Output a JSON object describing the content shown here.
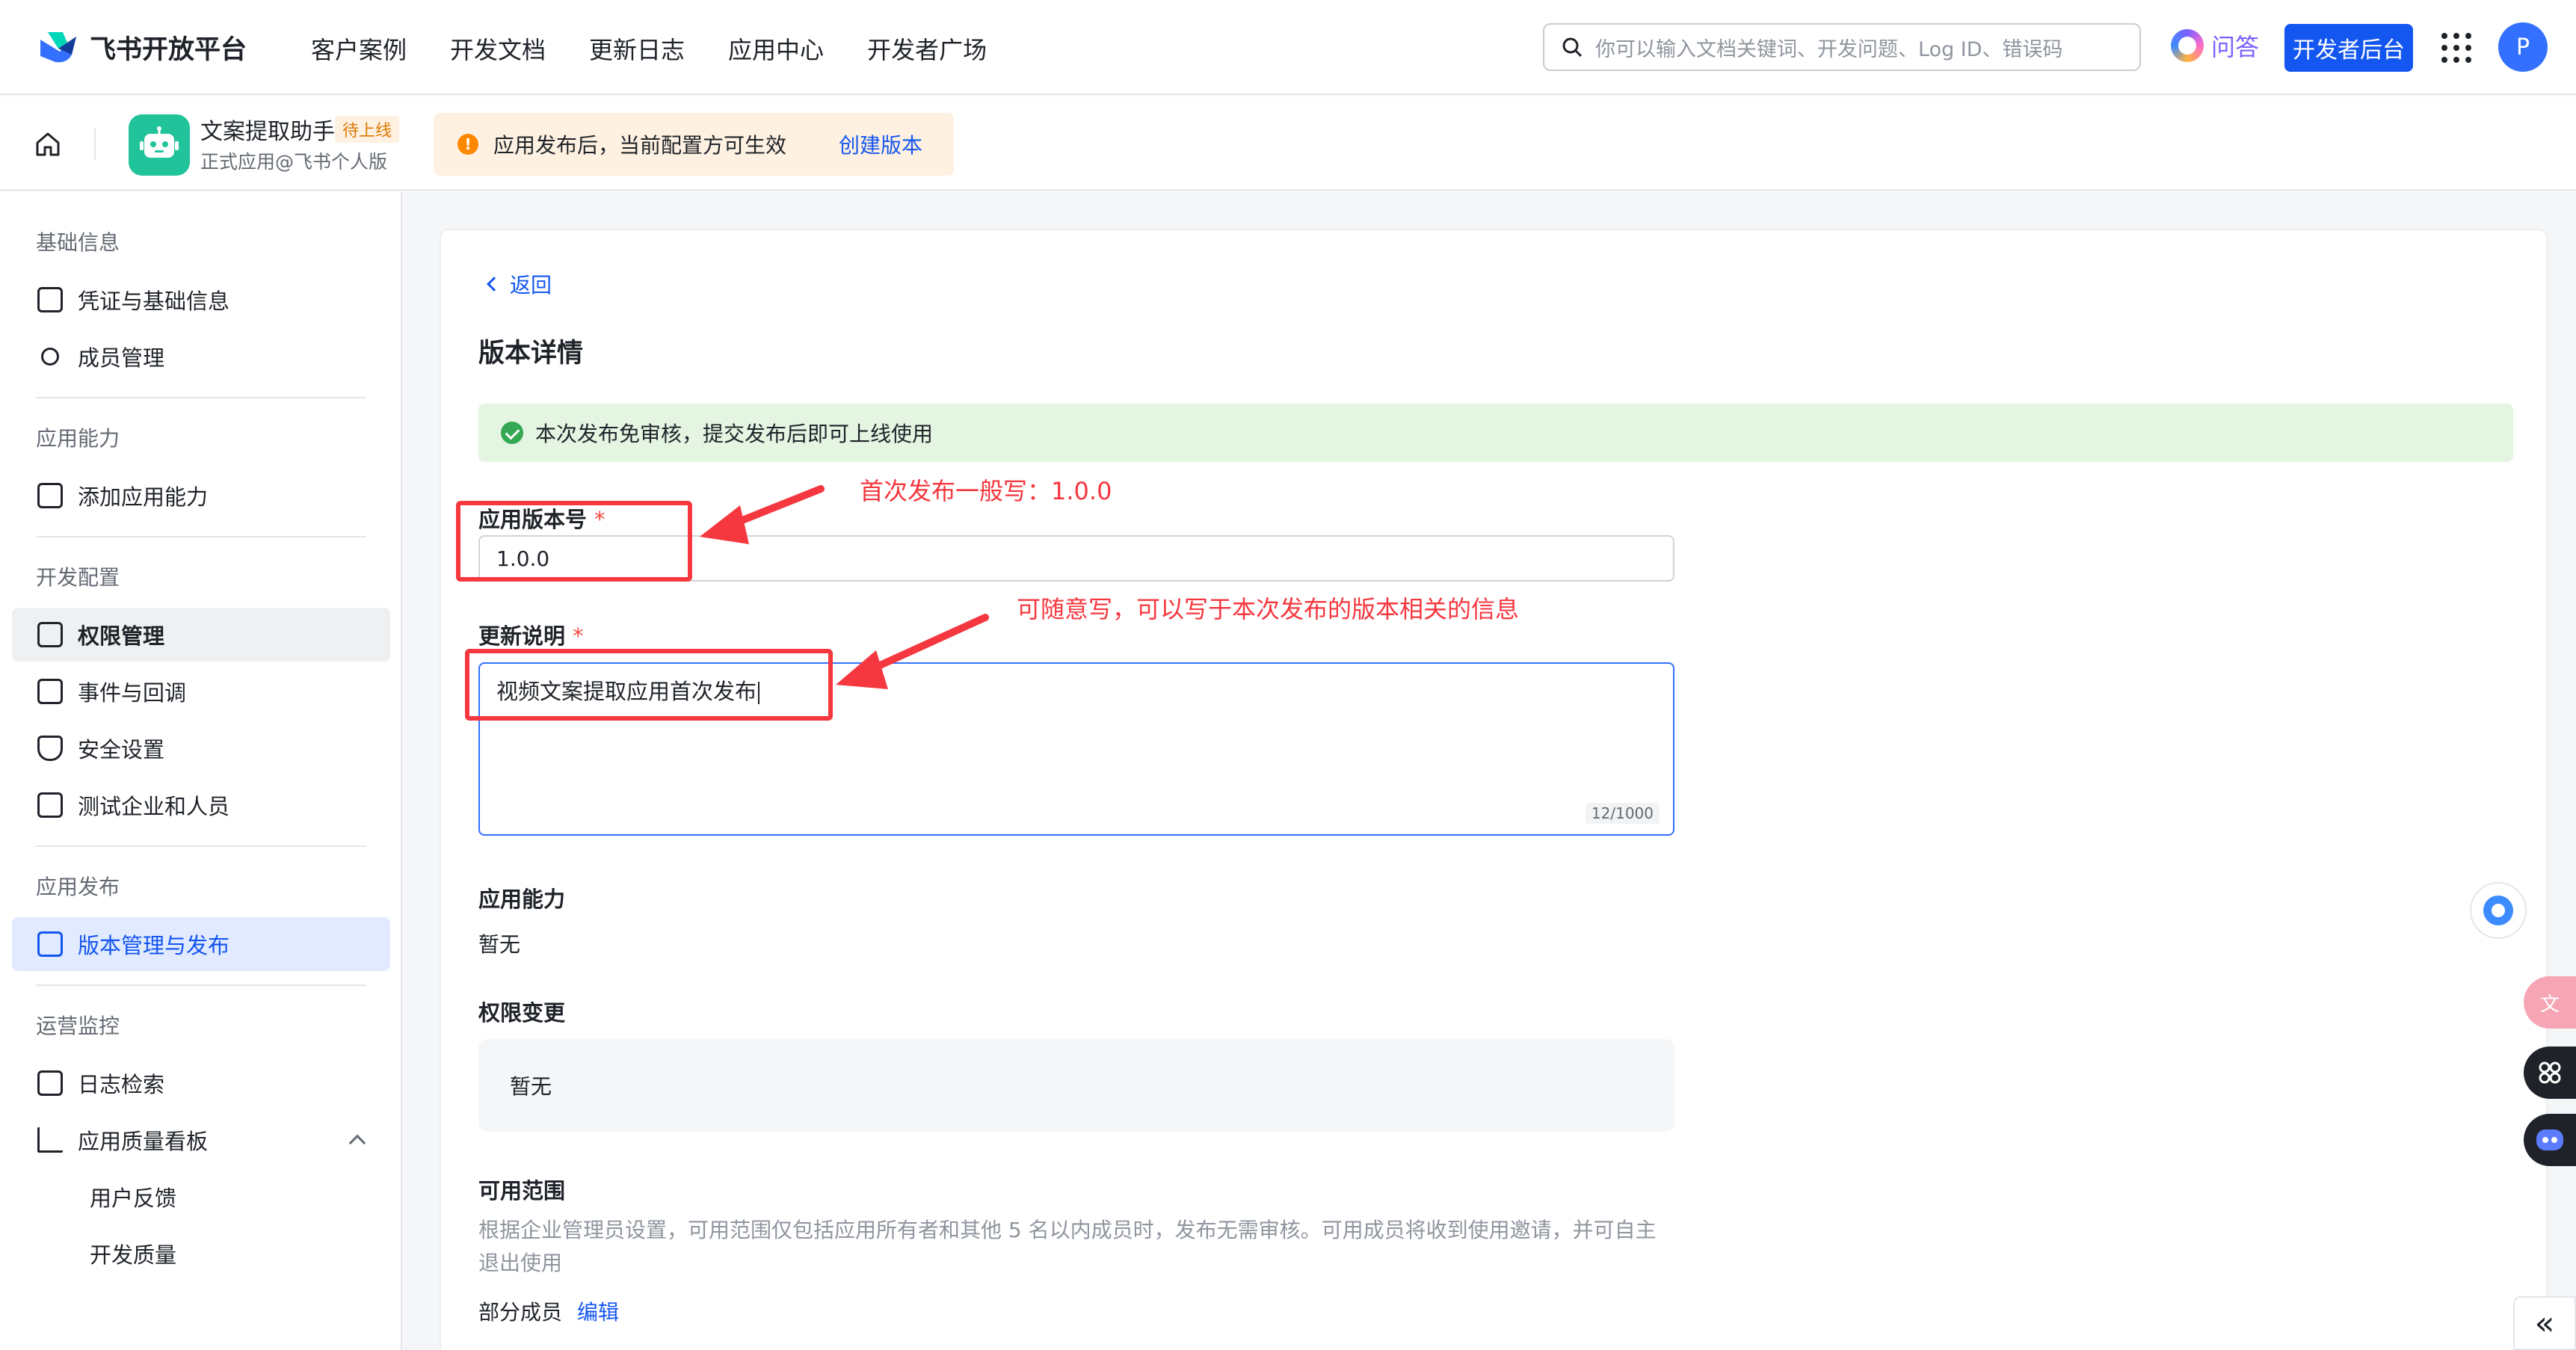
{
  "header": {
    "logo_text": "飞书开放平台",
    "nav": [
      "客户案例",
      "开发文档",
      "更新日志",
      "应用中心",
      "开发者广场"
    ],
    "search_placeholder": "你可以输入文档关键词、开发问题、Log ID、错误码",
    "qa_label": "问答",
    "dev_console_label": "开发者后台",
    "avatar_letter": "P"
  },
  "subheader": {
    "app_name": "文案提取助手",
    "app_status": "待上线",
    "app_type": "正式应用@飞书个人版",
    "notice_text": "应用发布后，当前配置方可生效",
    "notice_link": "创建版本"
  },
  "sidebar": {
    "sections": [
      {
        "title": "基础信息",
        "items": [
          "凭证与基础信息",
          "成员管理"
        ]
      },
      {
        "title": "应用能力",
        "items": [
          "添加应用能力"
        ]
      },
      {
        "title": "开发配置",
        "items": [
          "权限管理",
          "事件与回调",
          "安全设置",
          "测试企业和人员"
        ]
      },
      {
        "title": "应用发布",
        "items": [
          "版本管理与发布"
        ]
      },
      {
        "title": "运营监控",
        "items": [
          "日志检索",
          "应用质量看板",
          "用户反馈",
          "开发质量"
        ]
      }
    ]
  },
  "main": {
    "back_label": "返回",
    "title": "版本详情",
    "success_text": "本次发布免审核，提交发布后即可上线使用",
    "version_label": "应用版本号",
    "required_mark": "*",
    "version_value": "1.0.0",
    "notes_label": "更新说明",
    "notes_value": "视频文案提取应用首次发布",
    "notes_counter": "12/1000",
    "capability_label": "应用能力",
    "capability_value": "暂无",
    "permission_label": "权限变更",
    "permission_value": "暂无",
    "scope_label": "可用范围",
    "scope_desc": "根据企业管理员设置，可用范围仅包括应用所有者和其他 5 名以内成员时，发布无需审核。可用成员将收到使用邀请，并可自主退出使用",
    "members_label": "部分成员",
    "members_edit": "编辑"
  },
  "annotations": {
    "version_note": "首次发布一般写：1.0.0",
    "notes_note": "可随意写，可以写于本次发布的版本相关的信息"
  },
  "colors": {
    "primary": "#1456f0",
    "annotation_red": "#f5373f",
    "success_bg": "#e4f5e2",
    "warning_bg": "#fef1e1"
  }
}
